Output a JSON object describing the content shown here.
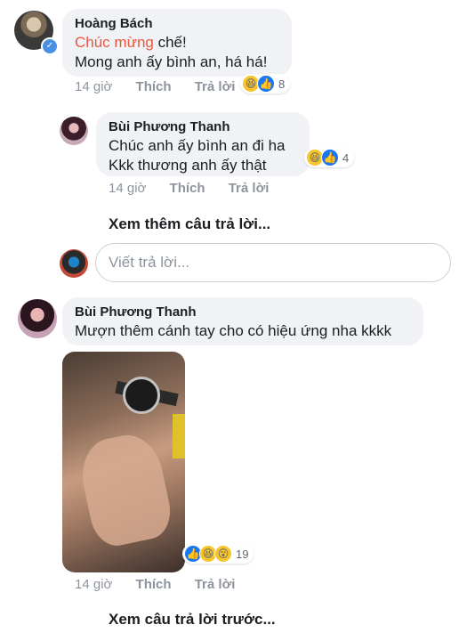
{
  "comment1": {
    "author": "Hoàng Bách",
    "line1_highlight": "Chúc mừng",
    "line1_rest": " chế!",
    "line2": "Mong anh ấy bình an, há há!",
    "meta": {
      "time": "14 giờ",
      "like": "Thích",
      "reply": "Trả lời"
    },
    "reactions": {
      "icons": [
        "haha-icon",
        "like-icon"
      ],
      "count": "8"
    }
  },
  "reply1": {
    "author": "Bùi Phương Thanh",
    "line1": "Chúc anh ấy bình an đi ha",
    "line2": "Kkk thương anh ấy thật",
    "meta": {
      "time": "14 giờ",
      "like": "Thích",
      "reply": "Trả lời"
    },
    "reactions": {
      "icons": [
        "haha-icon",
        "like-icon"
      ],
      "count": "4"
    }
  },
  "more_replies": "Xem thêm câu trả lời...",
  "reply_input": {
    "placeholder": "Viết trả lời..."
  },
  "comment2": {
    "author": "Bùi Phương Thanh",
    "text": "Mượn thêm cánh tay cho có hiệu ứng nha kkkk",
    "meta": {
      "time": "14 giờ",
      "like": "Thích",
      "reply": "Trả lời"
    },
    "reactions": {
      "icons": [
        "like-icon",
        "haha-icon",
        "wow-icon"
      ],
      "count": "19"
    }
  },
  "previous_replies": "Xem câu trả lời trước...",
  "colors": {
    "highlight": "#e9573f",
    "bubble": "#f0f2f5",
    "meta": "#8d949e",
    "like_blue": "#1877f2"
  }
}
